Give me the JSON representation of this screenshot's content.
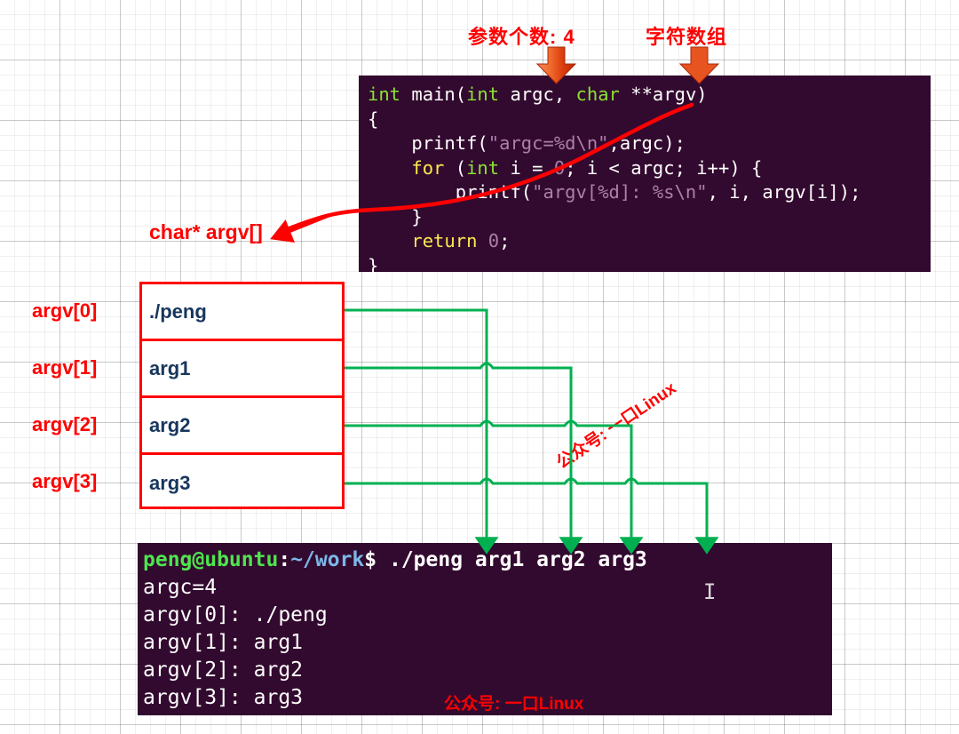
{
  "annotations": {
    "argc_note": "参数个数: 4",
    "argv_note": "字符数组",
    "charptr_note": "char* argv[]",
    "arrow_icon": "down-arrow-icon"
  },
  "code": {
    "language": "c",
    "lines": [
      [
        {
          "t": "int ",
          "c": "type"
        },
        {
          "t": "main(",
          "c": "plain"
        },
        {
          "t": "int ",
          "c": "type"
        },
        {
          "t": "argc, ",
          "c": "plain"
        },
        {
          "t": "char ",
          "c": "type"
        },
        {
          "t": "**argv)",
          "c": "plain"
        }
      ],
      [
        {
          "t": "{",
          "c": "plain"
        }
      ],
      [
        {
          "t": "    printf(",
          "c": "plain"
        },
        {
          "t": "\"argc=%d\\n\"",
          "c": "str"
        },
        {
          "t": ",argc);",
          "c": "plain"
        }
      ],
      [
        {
          "t": "    ",
          "c": "plain"
        },
        {
          "t": "for",
          "c": "kw"
        },
        {
          "t": " (",
          "c": "plain"
        },
        {
          "t": "int",
          "c": "type"
        },
        {
          "t": " i = ",
          "c": "plain"
        },
        {
          "t": "0",
          "c": "num"
        },
        {
          "t": "; i < argc; i++) {",
          "c": "plain"
        }
      ],
      [
        {
          "t": "        printf(",
          "c": "plain"
        },
        {
          "t": "\"argv[%d]: %s\\n\"",
          "c": "str"
        },
        {
          "t": ", i, argv[i]);",
          "c": "plain"
        }
      ],
      [
        {
          "t": "    }",
          "c": "plain"
        }
      ],
      [
        {
          "t": "    ",
          "c": "plain"
        },
        {
          "t": "return",
          "c": "kw"
        },
        {
          "t": " ",
          "c": "plain"
        },
        {
          "t": "0",
          "c": "num"
        },
        {
          "t": ";",
          "c": "plain"
        }
      ],
      [
        {
          "t": "}",
          "c": "plain"
        }
      ]
    ]
  },
  "argv_table": {
    "rows": [
      {
        "index": "argv[0]",
        "value": "./peng"
      },
      {
        "index": "argv[1]",
        "value": "arg1"
      },
      {
        "index": "argv[2]",
        "value": "arg2"
      },
      {
        "index": "argv[3]",
        "value": "arg3"
      }
    ]
  },
  "terminal": {
    "prompt_user": "peng@ubuntu",
    "prompt_colon": ":",
    "prompt_path": "~/work",
    "prompt_dollar": "$ ",
    "command": "./peng arg1 arg2 arg3",
    "output_lines": [
      "argc=4",
      "argv[0]: ./peng",
      "argv[1]: arg1",
      "argv[2]: arg2",
      "argv[3]: arg3"
    ],
    "watermark": "公众号: 一口Linux",
    "cursor_glyph": "I"
  },
  "watermark_diagonal": "公众号: 一口Linux",
  "colors": {
    "accent_red": "#ff0000",
    "connector_green": "#00b050",
    "code_bg": "#330a2f",
    "cell_text": "#17365d",
    "arrow_orange": "#e8541f"
  }
}
